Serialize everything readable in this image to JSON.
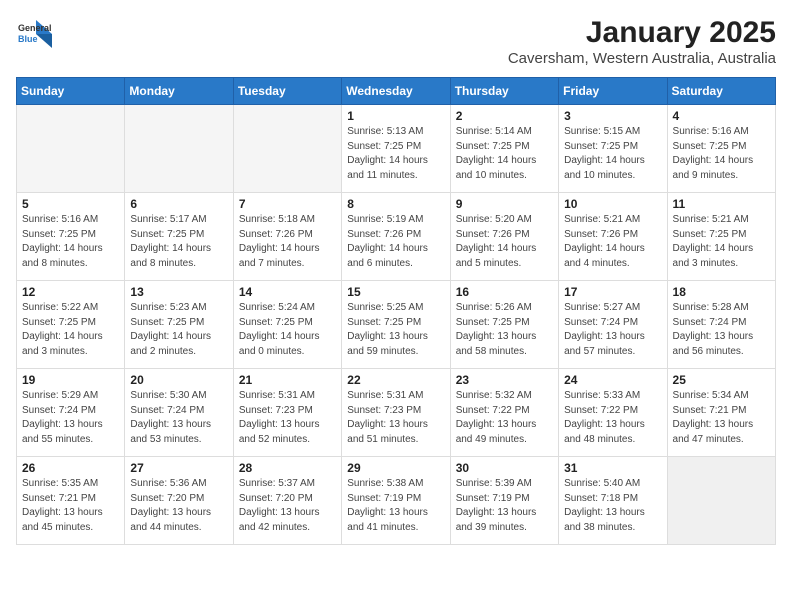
{
  "logo": {
    "general": "General",
    "blue": "Blue"
  },
  "title": "January 2025",
  "subtitle": "Caversham, Western Australia, Australia",
  "days_of_week": [
    "Sunday",
    "Monday",
    "Tuesday",
    "Wednesday",
    "Thursday",
    "Friday",
    "Saturday"
  ],
  "weeks": [
    [
      {
        "day": "",
        "detail": ""
      },
      {
        "day": "",
        "detail": ""
      },
      {
        "day": "",
        "detail": ""
      },
      {
        "day": "1",
        "detail": "Sunrise: 5:13 AM\nSunset: 7:25 PM\nDaylight: 14 hours\nand 11 minutes."
      },
      {
        "day": "2",
        "detail": "Sunrise: 5:14 AM\nSunset: 7:25 PM\nDaylight: 14 hours\nand 10 minutes."
      },
      {
        "day": "3",
        "detail": "Sunrise: 5:15 AM\nSunset: 7:25 PM\nDaylight: 14 hours\nand 10 minutes."
      },
      {
        "day": "4",
        "detail": "Sunrise: 5:16 AM\nSunset: 7:25 PM\nDaylight: 14 hours\nand 9 minutes."
      }
    ],
    [
      {
        "day": "5",
        "detail": "Sunrise: 5:16 AM\nSunset: 7:25 PM\nDaylight: 14 hours\nand 8 minutes."
      },
      {
        "day": "6",
        "detail": "Sunrise: 5:17 AM\nSunset: 7:25 PM\nDaylight: 14 hours\nand 8 minutes."
      },
      {
        "day": "7",
        "detail": "Sunrise: 5:18 AM\nSunset: 7:26 PM\nDaylight: 14 hours\nand 7 minutes."
      },
      {
        "day": "8",
        "detail": "Sunrise: 5:19 AM\nSunset: 7:26 PM\nDaylight: 14 hours\nand 6 minutes."
      },
      {
        "day": "9",
        "detail": "Sunrise: 5:20 AM\nSunset: 7:26 PM\nDaylight: 14 hours\nand 5 minutes."
      },
      {
        "day": "10",
        "detail": "Sunrise: 5:21 AM\nSunset: 7:26 PM\nDaylight: 14 hours\nand 4 minutes."
      },
      {
        "day": "11",
        "detail": "Sunrise: 5:21 AM\nSunset: 7:25 PM\nDaylight: 14 hours\nand 3 minutes."
      }
    ],
    [
      {
        "day": "12",
        "detail": "Sunrise: 5:22 AM\nSunset: 7:25 PM\nDaylight: 14 hours\nand 3 minutes."
      },
      {
        "day": "13",
        "detail": "Sunrise: 5:23 AM\nSunset: 7:25 PM\nDaylight: 14 hours\nand 2 minutes."
      },
      {
        "day": "14",
        "detail": "Sunrise: 5:24 AM\nSunset: 7:25 PM\nDaylight: 14 hours\nand 0 minutes."
      },
      {
        "day": "15",
        "detail": "Sunrise: 5:25 AM\nSunset: 7:25 PM\nDaylight: 13 hours\nand 59 minutes."
      },
      {
        "day": "16",
        "detail": "Sunrise: 5:26 AM\nSunset: 7:25 PM\nDaylight: 13 hours\nand 58 minutes."
      },
      {
        "day": "17",
        "detail": "Sunrise: 5:27 AM\nSunset: 7:24 PM\nDaylight: 13 hours\nand 57 minutes."
      },
      {
        "day": "18",
        "detail": "Sunrise: 5:28 AM\nSunset: 7:24 PM\nDaylight: 13 hours\nand 56 minutes."
      }
    ],
    [
      {
        "day": "19",
        "detail": "Sunrise: 5:29 AM\nSunset: 7:24 PM\nDaylight: 13 hours\nand 55 minutes."
      },
      {
        "day": "20",
        "detail": "Sunrise: 5:30 AM\nSunset: 7:24 PM\nDaylight: 13 hours\nand 53 minutes."
      },
      {
        "day": "21",
        "detail": "Sunrise: 5:31 AM\nSunset: 7:23 PM\nDaylight: 13 hours\nand 52 minutes."
      },
      {
        "day": "22",
        "detail": "Sunrise: 5:31 AM\nSunset: 7:23 PM\nDaylight: 13 hours\nand 51 minutes."
      },
      {
        "day": "23",
        "detail": "Sunrise: 5:32 AM\nSunset: 7:22 PM\nDaylight: 13 hours\nand 49 minutes."
      },
      {
        "day": "24",
        "detail": "Sunrise: 5:33 AM\nSunset: 7:22 PM\nDaylight: 13 hours\nand 48 minutes."
      },
      {
        "day": "25",
        "detail": "Sunrise: 5:34 AM\nSunset: 7:21 PM\nDaylight: 13 hours\nand 47 minutes."
      }
    ],
    [
      {
        "day": "26",
        "detail": "Sunrise: 5:35 AM\nSunset: 7:21 PM\nDaylight: 13 hours\nand 45 minutes."
      },
      {
        "day": "27",
        "detail": "Sunrise: 5:36 AM\nSunset: 7:20 PM\nDaylight: 13 hours\nand 44 minutes."
      },
      {
        "day": "28",
        "detail": "Sunrise: 5:37 AM\nSunset: 7:20 PM\nDaylight: 13 hours\nand 42 minutes."
      },
      {
        "day": "29",
        "detail": "Sunrise: 5:38 AM\nSunset: 7:19 PM\nDaylight: 13 hours\nand 41 minutes."
      },
      {
        "day": "30",
        "detail": "Sunrise: 5:39 AM\nSunset: 7:19 PM\nDaylight: 13 hours\nand 39 minutes."
      },
      {
        "day": "31",
        "detail": "Sunrise: 5:40 AM\nSunset: 7:18 PM\nDaylight: 13 hours\nand 38 minutes."
      },
      {
        "day": "",
        "detail": ""
      }
    ]
  ]
}
